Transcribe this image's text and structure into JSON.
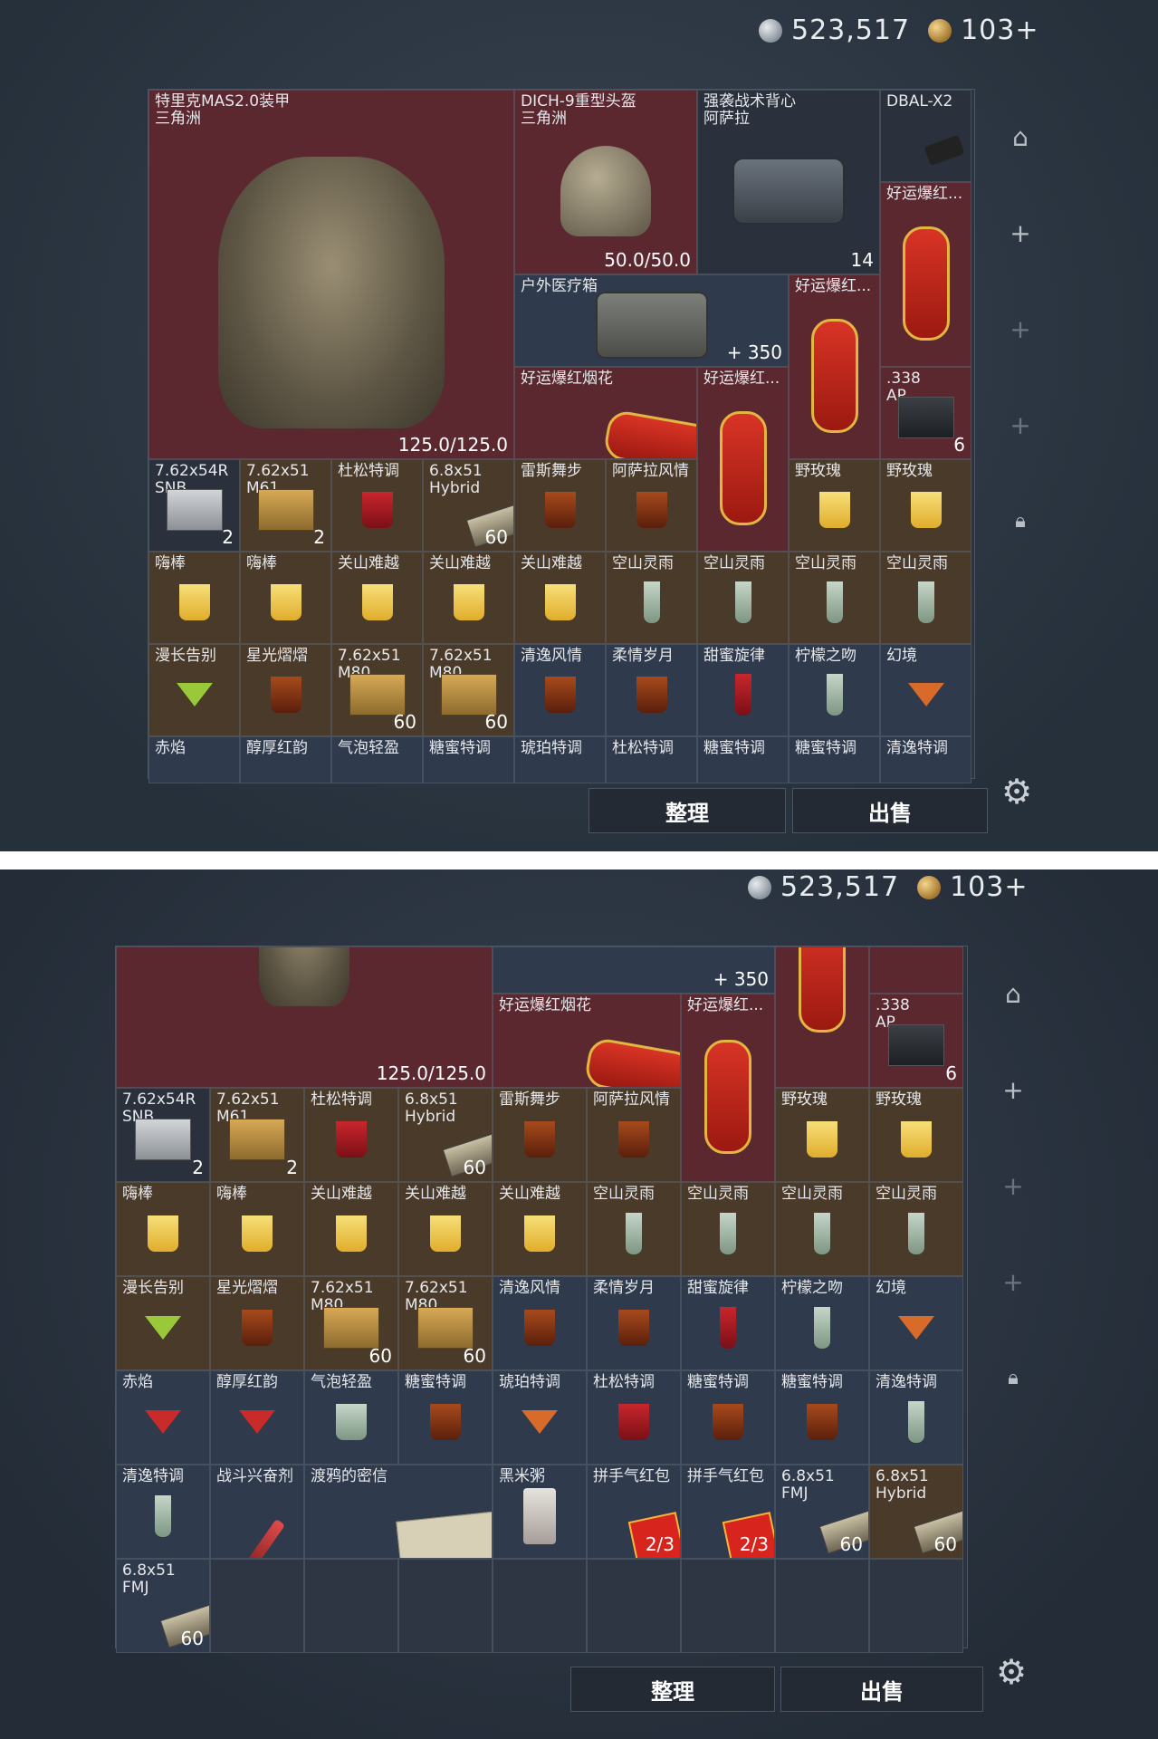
{
  "currency": {
    "silver": "523,517",
    "gold": "103+"
  },
  "buttons": {
    "sort": "整理",
    "sell": "出售"
  },
  "sidebar": [
    "backpack-icon",
    "plus-icon",
    "plus-icon",
    "plus-icon",
    "lock-icon"
  ],
  "top": {
    "big": [
      {
        "label": "特里克MAS2.0装甲\n三角洲",
        "count": "125.0/125.0"
      },
      {
        "label": "DICH-9重型头盔\n三角洲",
        "count": "50.0/50.0"
      },
      {
        "label": "强袭战术背心\n阿萨拉",
        "count": "14"
      },
      {
        "label": "DBAL-X2",
        "count": ""
      },
      {
        "label": "好运爆红...",
        "count": ""
      },
      {
        "label": "户外医疗箱",
        "count": "+ 350"
      },
      {
        "label": "好运爆红...",
        "count": ""
      },
      {
        "label": "好运爆红烟花",
        "count": ""
      },
      {
        "label": "好运爆红...",
        "count": ""
      },
      {
        "label": ".338\nAP",
        "count": "6"
      }
    ],
    "row1": [
      {
        "label": "7.62x54R\nSNB",
        "count": "2"
      },
      {
        "label": "7.62x51\nM61",
        "count": "2"
      },
      {
        "label": "杜松特调",
        "count": ""
      },
      {
        "label": "6.8x51\nHybrid",
        "count": "60"
      },
      {
        "label": "雷斯舞步",
        "count": ""
      },
      {
        "label": "阿萨拉风情",
        "count": ""
      },
      {
        "label": "",
        "count": ""
      },
      {
        "label": "野玫瑰",
        "count": ""
      },
      {
        "label": "野玫瑰",
        "count": ""
      }
    ],
    "row2": [
      "嗨棒",
      "嗨棒",
      "关山难越",
      "关山难越",
      "关山难越",
      "空山灵雨",
      "空山灵雨",
      "空山灵雨",
      "空山灵雨"
    ],
    "row3": [
      {
        "label": "漫长告别",
        "count": ""
      },
      {
        "label": "星光熠熠",
        "count": ""
      },
      {
        "label": "7.62x51\nM80",
        "count": "60"
      },
      {
        "label": "7.62x51\nM80",
        "count": "60"
      },
      {
        "label": "清逸风情",
        "count": ""
      },
      {
        "label": "柔情岁月",
        "count": ""
      },
      {
        "label": "甜蜜旋律",
        "count": ""
      },
      {
        "label": "柠檬之吻",
        "count": ""
      },
      {
        "label": "幻境",
        "count": ""
      }
    ],
    "row4": [
      "赤焰",
      "醇厚红韵",
      "气泡轻盈",
      "糖蜜特调",
      "琥珀特调",
      "杜松特调",
      "糖蜜特调",
      "糖蜜特调",
      "清逸特调"
    ]
  },
  "bottom": {
    "upper": [
      {
        "label": "",
        "count": "+ 350"
      },
      {
        "label": "好运爆红烟花",
        "count": ""
      },
      {
        "label": "好运爆红...",
        "count": ""
      },
      {
        "label": ".338\nAP",
        "count": "6"
      },
      {
        "label": "",
        "count": "125.0/125.0"
      }
    ],
    "row1": [
      {
        "label": "7.62x54R\nSNB",
        "count": "2"
      },
      {
        "label": "7.62x51\nM61",
        "count": "2"
      },
      {
        "label": "杜松特调",
        "count": ""
      },
      {
        "label": "6.8x51\nHybrid",
        "count": "60"
      },
      {
        "label": "雷斯舞步",
        "count": ""
      },
      {
        "label": "阿萨拉风情",
        "count": ""
      },
      {
        "label": "",
        "count": ""
      },
      {
        "label": "野玫瑰",
        "count": ""
      },
      {
        "label": "野玫瑰",
        "count": ""
      }
    ],
    "row2": [
      "嗨棒",
      "嗨棒",
      "关山难越",
      "关山难越",
      "关山难越",
      "空山灵雨",
      "空山灵雨",
      "空山灵雨",
      "空山灵雨"
    ],
    "row3": [
      {
        "label": "漫长告别",
        "count": ""
      },
      {
        "label": "星光熠熠",
        "count": ""
      },
      {
        "label": "7.62x51\nM80",
        "count": "60"
      },
      {
        "label": "7.62x51\nM80",
        "count": "60"
      },
      {
        "label": "清逸风情",
        "count": ""
      },
      {
        "label": "柔情岁月",
        "count": ""
      },
      {
        "label": "甜蜜旋律",
        "count": ""
      },
      {
        "label": "柠檬之吻",
        "count": ""
      },
      {
        "label": "幻境",
        "count": ""
      }
    ],
    "row4": [
      "赤焰",
      "醇厚红韵",
      "气泡轻盈",
      "糖蜜特调",
      "琥珀特调",
      "杜松特调",
      "糖蜜特调",
      "糖蜜特调",
      "清逸特调"
    ],
    "row5": [
      {
        "label": "清逸特调",
        "count": ""
      },
      {
        "label": "战斗兴奋剂",
        "count": ""
      },
      {
        "label": "渡鸦的密信",
        "count": ""
      },
      {
        "label": "黑米粥",
        "count": ""
      },
      {
        "label": "拼手气红包",
        "count": "2/3"
      },
      {
        "label": "拼手气红包",
        "count": "2/3"
      },
      {
        "label": "6.8x51\nFMJ",
        "count": "60"
      },
      {
        "label": "6.8x51\nHybrid",
        "count": "60"
      }
    ],
    "row6": [
      {
        "label": "6.8x51\nFMJ",
        "count": "60"
      }
    ]
  }
}
